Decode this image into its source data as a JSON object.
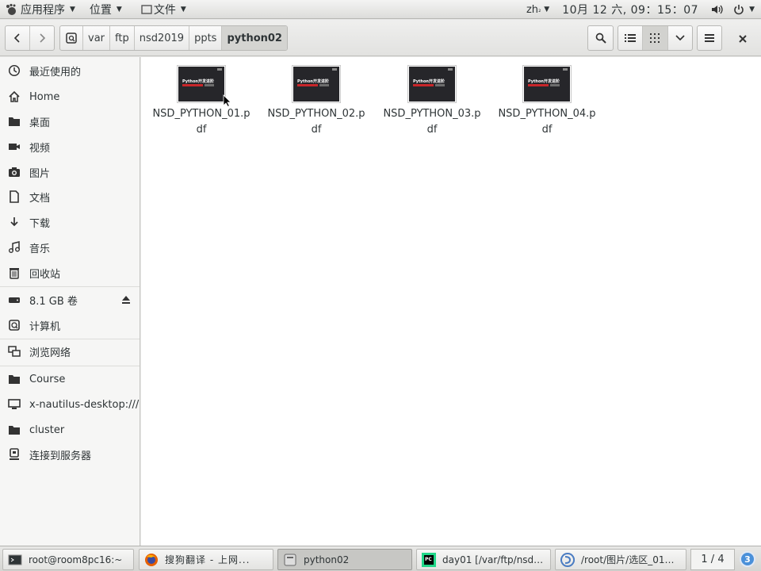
{
  "top_panel": {
    "applications_label": "应用程序",
    "places_label": "位置",
    "app_menu_label": "文件",
    "input_method": "zh",
    "clock": "10月 12 六, 09：15：07"
  },
  "header": {
    "breadcrumb": [
      "var",
      "ftp",
      "nsd2019",
      "ppts",
      "python02"
    ]
  },
  "sidebar": {
    "items": [
      {
        "label": "最近使用的",
        "icon": "recent-icon"
      },
      {
        "label": "Home",
        "icon": "home-icon"
      },
      {
        "label": "桌面",
        "icon": "folder-icon"
      },
      {
        "label": "视频",
        "icon": "video-icon"
      },
      {
        "label": "图片",
        "icon": "camera-icon"
      },
      {
        "label": "文档",
        "icon": "document-icon"
      },
      {
        "label": "下载",
        "icon": "download-icon"
      },
      {
        "label": "音乐",
        "icon": "music-icon"
      },
      {
        "label": "回收站",
        "icon": "trash-icon"
      },
      {
        "label": "8.1 GB 卷",
        "icon": "drive-icon"
      },
      {
        "label": "计算机",
        "icon": "computer-icon"
      },
      {
        "label": "浏览网络",
        "icon": "network-icon"
      },
      {
        "label": "Course",
        "icon": "folder-icon"
      },
      {
        "label": "x-nautilus-desktop:///",
        "icon": "desktop-icon"
      },
      {
        "label": "cluster",
        "icon": "folder-icon"
      },
      {
        "label": "连接到服务器",
        "icon": "server-icon"
      }
    ]
  },
  "files": [
    {
      "name": "NSD_PYTHON_01.pdf",
      "thumb_text": "Python开发进阶"
    },
    {
      "name": "NSD_PYTHON_02.pdf",
      "thumb_text": "Python开发进阶"
    },
    {
      "name": "NSD_PYTHON_03.pdf",
      "thumb_text": "Python开发进阶"
    },
    {
      "name": "NSD_PYTHON_04.pdf",
      "thumb_text": "Python开发进阶"
    }
  ],
  "taskbar": {
    "tasks": [
      {
        "label": "root@room8pc16:~",
        "icon": "terminal-icon"
      },
      {
        "label": "搜狗翻译 - 上网...",
        "icon": "firefox-icon"
      },
      {
        "label": "python02",
        "icon": "files-icon"
      },
      {
        "label": "day01 [/var/ftp/nsd…",
        "icon": "pycharm-icon"
      },
      {
        "label": "/root/图片/选区_01…",
        "icon": "image-viewer-icon"
      }
    ],
    "pager": "1 / 4",
    "notification_count": "3"
  }
}
